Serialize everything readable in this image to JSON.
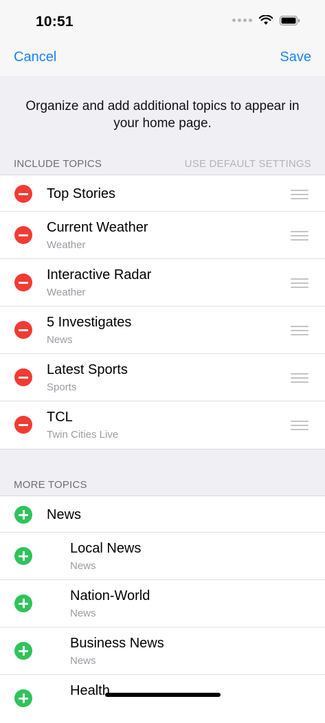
{
  "status": {
    "time": "10:51"
  },
  "nav": {
    "cancel": "Cancel",
    "save": "Save"
  },
  "intro_text": "Organize and add additional topics to appear in your home page.",
  "include_section": {
    "title": "INCLUDE TOPICS",
    "default_link": "USE DEFAULT SETTINGS"
  },
  "included_topics": [
    {
      "title": "Top Stories",
      "subtitle": ""
    },
    {
      "title": "Current Weather",
      "subtitle": "Weather"
    },
    {
      "title": "Interactive Radar",
      "subtitle": "Weather"
    },
    {
      "title": "5 Investigates",
      "subtitle": "News"
    },
    {
      "title": "Latest Sports",
      "subtitle": "Sports"
    },
    {
      "title": "TCL",
      "subtitle": "Twin Cities Live"
    }
  ],
  "more_section": {
    "title": "MORE TOPICS"
  },
  "more_topics": [
    {
      "title": "News",
      "subtitle": ""
    },
    {
      "title": "Local News",
      "subtitle": "News"
    },
    {
      "title": "Nation-World",
      "subtitle": "News"
    },
    {
      "title": "Business News",
      "subtitle": "News"
    },
    {
      "title": "Health",
      "subtitle": ""
    }
  ],
  "colors": {
    "accent": "#1a82f6",
    "remove": "#f23b33",
    "add": "#2fc35a"
  }
}
